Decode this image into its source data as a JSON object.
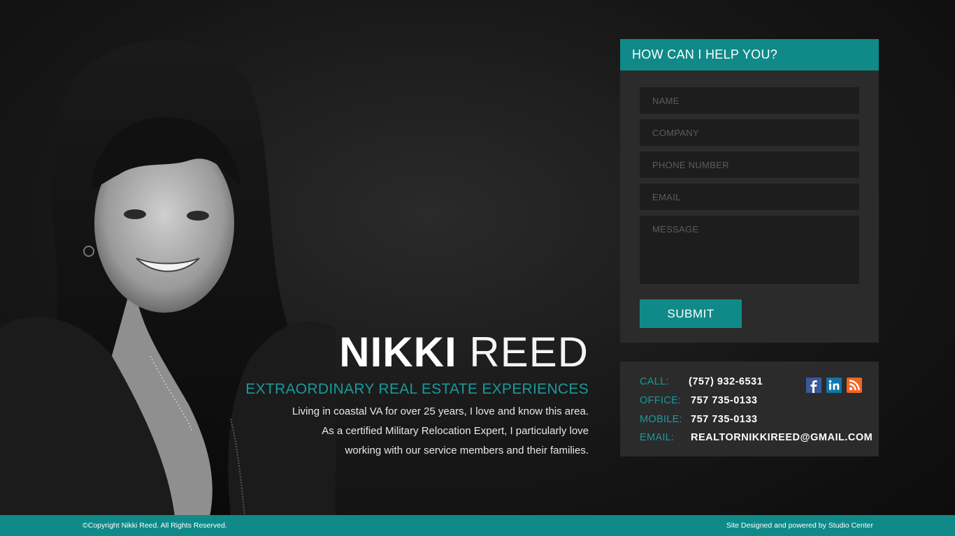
{
  "hero": {
    "first_name": "NIKKI",
    "last_name": "REED",
    "tagline": "EXTRAORDINARY REAL ESTATE EXPERIENCES",
    "bio_lines": [
      "Living in coastal VA for over 25 years, I love and know this area.",
      "As a certified Military Relocation Expert, I particularly love",
      "working with our service members and their families."
    ]
  },
  "form": {
    "title": "HOW CAN I HELP YOU?",
    "placeholders": {
      "name": "NAME",
      "company": "COMPANY",
      "phone": "PHONE NUMBER",
      "email": "EMAIL",
      "message": "MESSAGE"
    },
    "submit_label": "SUBMIT"
  },
  "contact": {
    "call_label": "CALL:",
    "call_value": "(757) 932-6531",
    "office_label": "OFFICE:",
    "office_value": "757 735-0133",
    "mobile_label": "MOBILE:",
    "mobile_value": "757 735-0133",
    "email_label": "EMAIL:",
    "email_value": "REALTORNIKKIREED@GMAIL.COM",
    "social_icons": [
      "facebook-icon",
      "linkedin-icon",
      "rss-icon"
    ]
  },
  "footer": {
    "copyright": "©Copyright Nikki Reed. All Rights Reserved.",
    "credit": "Site Designed and powered by Studio Center"
  },
  "colors": {
    "accent": "#0f8a88",
    "accent_text": "#1a9a9a",
    "card_bg": "#2b2b2b",
    "field_bg": "#1d1d1d",
    "page_bg": "#141414"
  }
}
